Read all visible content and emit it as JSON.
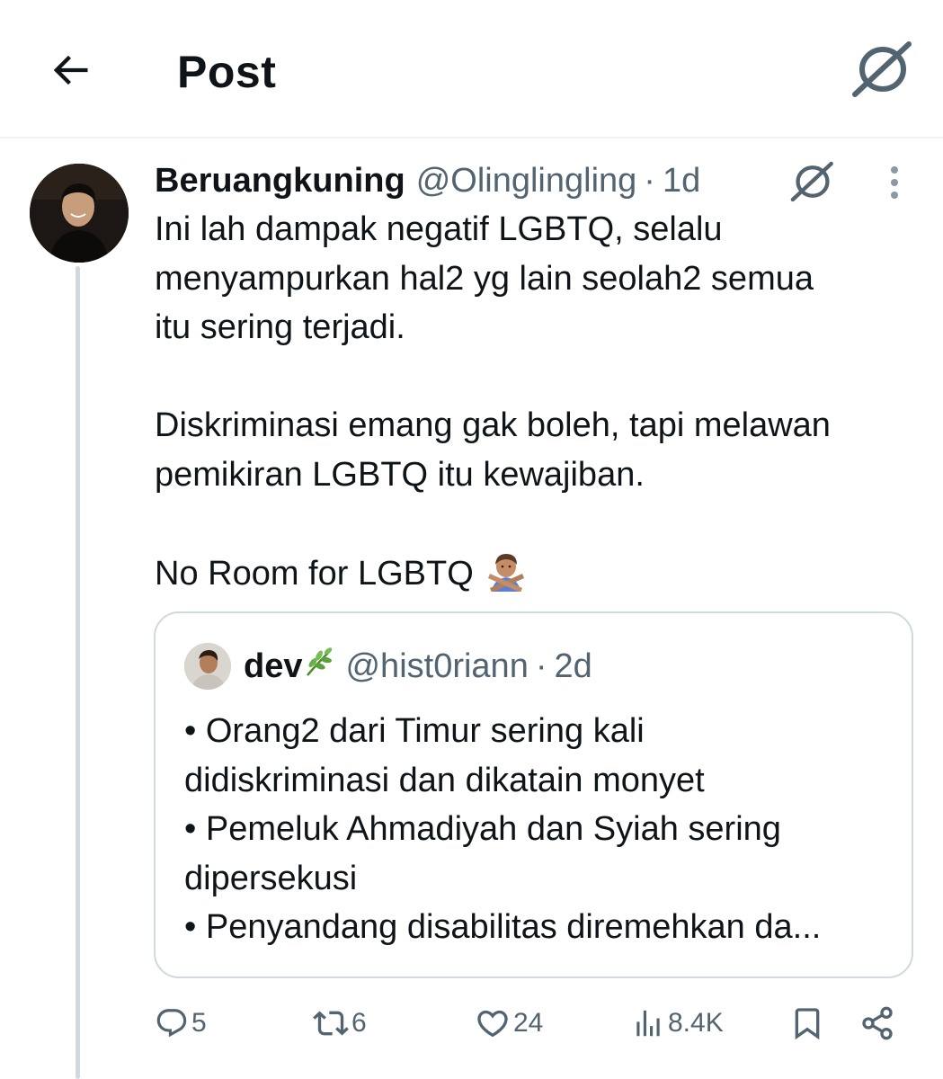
{
  "header": {
    "title": "Post",
    "back_icon": "arrow-left-icon",
    "grok_icon": "grok-icon"
  },
  "post": {
    "author_name": "Beruangkuning",
    "author_handle": "@Olinglingling",
    "separator": "·",
    "time": "1d",
    "paragraphs": [
      [
        "Ini lah dampak negatif LGBTQ, selalu",
        "menyampurkan hal2 yg lain seolah2 semua",
        "itu sering terjadi."
      ],
      [
        "Diskriminasi emang gak boleh, tapi melawan",
        "pemikiran LGBTQ itu kewajiban."
      ],
      [
        "No Room for LGBTQ"
      ]
    ],
    "emoji": "person-gesturing-no-emoji"
  },
  "quote": {
    "author_name": "dev",
    "name_emoji": "herb-emoji",
    "author_handle": "@hist0riann",
    "separator": "·",
    "time": "2d",
    "lines": [
      "• Orang2 dari Timur sering kali",
      "didiskriminasi dan dikatain monyet",
      "• Pemeluk Ahmadiyah dan Syiah sering",
      "dipersekusi",
      "• Penyandang disabilitas diremehkan da..."
    ]
  },
  "actions": {
    "replies": "5",
    "reposts": "6",
    "likes": "24",
    "views": "8.4K"
  },
  "colors": {
    "text": "#0f1419",
    "secondary": "#536471",
    "border": "#cfd9de",
    "divider": "#eff3f4"
  }
}
